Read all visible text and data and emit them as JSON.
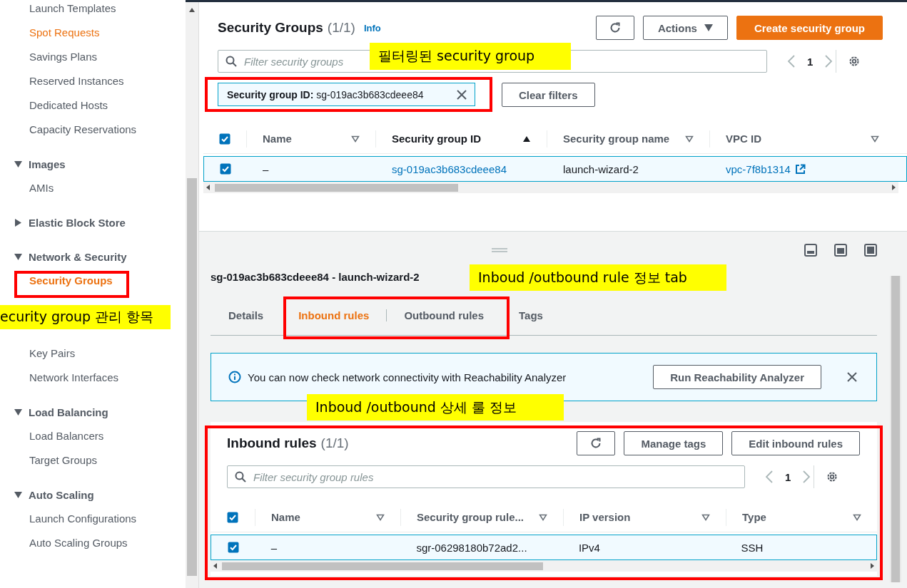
{
  "sidebar": {
    "groups": [
      {
        "kind": "plain",
        "items": [
          {
            "label": "Launch Templates",
            "selected": false,
            "hovered": false
          },
          {
            "label": "Spot Requests",
            "selected": false,
            "hovered": true
          },
          {
            "label": "Savings Plans",
            "selected": false,
            "hovered": false
          },
          {
            "label": "Reserved Instances",
            "selected": false,
            "hovered": false
          },
          {
            "label": "Dedicated Hosts",
            "selected": false,
            "hovered": false
          },
          {
            "label": "Capacity Reservations",
            "selected": false,
            "hovered": false
          }
        ]
      },
      {
        "kind": "section",
        "label": "Images",
        "expanded": true,
        "items": [
          {
            "label": "AMIs",
            "selected": false,
            "hovered": false
          }
        ]
      },
      {
        "kind": "section",
        "label": "Elastic Block Store",
        "expanded": false
      },
      {
        "kind": "section",
        "label": "Network & Security",
        "expanded": true,
        "items": [
          {
            "kind": "link",
            "label": "Security Groups",
            "selected": true,
            "hovered": false
          },
          {
            "kind": "note",
            "label": "ecurity group 관리 항목"
          },
          {
            "kind": "link",
            "label": "Key Pairs",
            "selected": false,
            "hovered": false
          },
          {
            "kind": "link",
            "label": "Network Interfaces",
            "selected": false,
            "hovered": false
          }
        ]
      },
      {
        "kind": "section",
        "label": "Load Balancing",
        "expanded": true,
        "items": [
          {
            "label": "Load Balancers",
            "selected": false,
            "hovered": false
          },
          {
            "label": "Target Groups",
            "selected": false,
            "hovered": false
          }
        ]
      },
      {
        "kind": "section",
        "label": "Auto Scaling",
        "expanded": true,
        "items": [
          {
            "label": "Launch Configurations",
            "selected": false,
            "hovered": false
          },
          {
            "label": "Auto Scaling Groups",
            "selected": false,
            "hovered": false
          }
        ]
      }
    ]
  },
  "groups_panel": {
    "title": "Security Groups",
    "count": "(1/1)",
    "info": "Info",
    "actions": "Actions",
    "create": "Create security group",
    "search_placeholder": "Filter security groups",
    "page": "1",
    "filter": "**Security group ID:** sg-019ac3b683cdeee84",
    "clear": "Clear filters",
    "table": {
      "all_checked": true,
      "columns": [
        {
          "label": "Name",
          "sorted": false
        },
        {
          "label": "Security group ID",
          "sorted": true
        },
        {
          "label": "Security group name",
          "sorted": false
        },
        {
          "label": "VPC ID",
          "sorted": false
        }
      ],
      "rows": [
        {
          "checked": true,
          "cells": [
            {
              "kind": "text",
              "text": "–"
            },
            {
              "kind": "link",
              "text": "sg-019ac3b683cdeee84"
            },
            {
              "kind": "text",
              "text": "launch-wizard-2"
            },
            {
              "kind": "external",
              "text": "vpc-7f8b1314"
            }
          ]
        }
      ]
    }
  },
  "detail_panel": {
    "title": "sg-019ac3b683cdeee84 - launch-wizard-2",
    "tabs": [
      {
        "label": "Details",
        "selected": false
      },
      {
        "label": "Inbound rules",
        "selected": true
      },
      {
        "label": "Outbound rules",
        "selected": false
      },
      {
        "label": "Tags",
        "selected": false
      }
    ],
    "alert": {
      "text": "You can now check network connectivity with Reachability Analyzer",
      "button": "Run Reachability Analyzer"
    },
    "rules": {
      "title": "Inbound rules",
      "count": "(1/1)",
      "buttons": [
        "Manage tags",
        "Edit inbound rules"
      ],
      "search_placeholder": "Filter security group rules",
      "page": "1",
      "table": {
        "all_checked": true,
        "columns": [
          {
            "label": "Name",
            "sorted": false
          },
          {
            "label": "Security group rule...",
            "sorted": false
          },
          {
            "label": "IP version",
            "sorted": false
          },
          {
            "label": "Type",
            "sorted": false
          }
        ],
        "rows": [
          {
            "checked": true,
            "cells": [
              {
                "kind": "text",
                "text": "–"
              },
              {
                "kind": "text",
                "text": "sgr-06298180b72ad2..."
              },
              {
                "kind": "text",
                "text": "IPv4"
              },
              {
                "kind": "text",
                "text": "SSH"
              }
            ]
          }
        ]
      }
    }
  },
  "annotations": [
    {
      "text": "필터링된 security group"
    },
    {
      "text": "Inboud /outbound rule 정보 tab"
    },
    {
      "text": "Inboud /outbound 상세 룰 정보"
    }
  ]
}
